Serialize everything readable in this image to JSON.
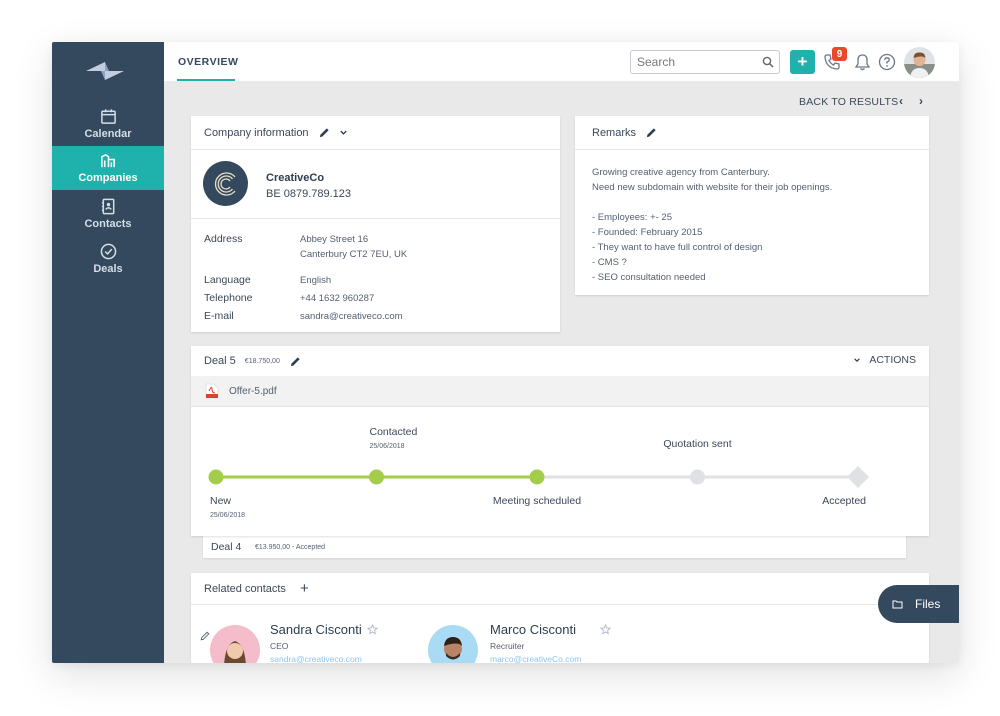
{
  "sidebar": {
    "items": [
      {
        "label": "Calendar",
        "icon": "calendar-icon",
        "active": false
      },
      {
        "label": "Companies",
        "icon": "buildings-icon",
        "active": true
      },
      {
        "label": "Contacts",
        "icon": "contact-book-icon",
        "active": false
      },
      {
        "label": "Deals",
        "icon": "check-circle-icon",
        "active": false
      }
    ]
  },
  "topbar": {
    "tab": "OVERVIEW",
    "search_placeholder": "Search",
    "add_label": "+",
    "phone_badge": "9"
  },
  "navigation": {
    "back_label": "BACK TO RESULTS",
    "prev": "‹",
    "next": "›"
  },
  "company": {
    "title": "Company information",
    "name": "CreativeCo",
    "vat": "BE 0879.789.123",
    "fields": [
      {
        "label": "Address",
        "value": "Abbey Street 16",
        "value2": "Canterbury CT2 7EU, UK"
      },
      {
        "label": "Language",
        "value": "English"
      },
      {
        "label": "Telephone",
        "value": "+44 1632 960287"
      },
      {
        "label": "E-mail",
        "value": "sandra@creativeco.com"
      }
    ]
  },
  "remarks": {
    "title": "Remarks",
    "lines": [
      "Growing creative agency from Canterbury.",
      "Need new subdomain with website for their job openings.",
      "",
      "- Employees: +- 25",
      "- Founded: February 2015",
      "- They want to have full control of design",
      "- CMS ?",
      "- SEO consultation needed"
    ]
  },
  "deal": {
    "title": "Deal 5",
    "amount": "€18.750,00",
    "actions_label": "ACTIONS",
    "file": "Offer-5.pdf",
    "stages": [
      {
        "label": "New",
        "date": "25/06/2018",
        "done": true,
        "label_pos": "below"
      },
      {
        "label": "Contacted",
        "date": "25/06/2018",
        "done": true,
        "label_pos": "above"
      },
      {
        "label": "Meeting scheduled",
        "date": "",
        "done": true,
        "label_pos": "below"
      },
      {
        "label": "Quotation sent",
        "date": "",
        "done": false,
        "label_pos": "above"
      },
      {
        "label": "Accepted",
        "date": "",
        "done": false,
        "label_pos": "below"
      }
    ],
    "progress_stage_index": 2,
    "colors": {
      "done": "#a4cd4a",
      "pending": "#e0e1e4"
    }
  },
  "deal4": {
    "title": "Deal 4",
    "meta": "€13.950,00 - Accepted"
  },
  "related": {
    "title": "Related contacts",
    "add": "+",
    "contacts": [
      {
        "name": "Sandra Cisconti",
        "role": "CEO",
        "email": "sandra@creativeco.com"
      },
      {
        "name": "Marco Cisconti",
        "role": "Recruiter",
        "email": "marco@creativeCo.com"
      }
    ]
  },
  "files_button": "Files",
  "colors": {
    "sidebar": "#34495e",
    "accent": "#1fb2ad",
    "badge": "#e8492b"
  }
}
